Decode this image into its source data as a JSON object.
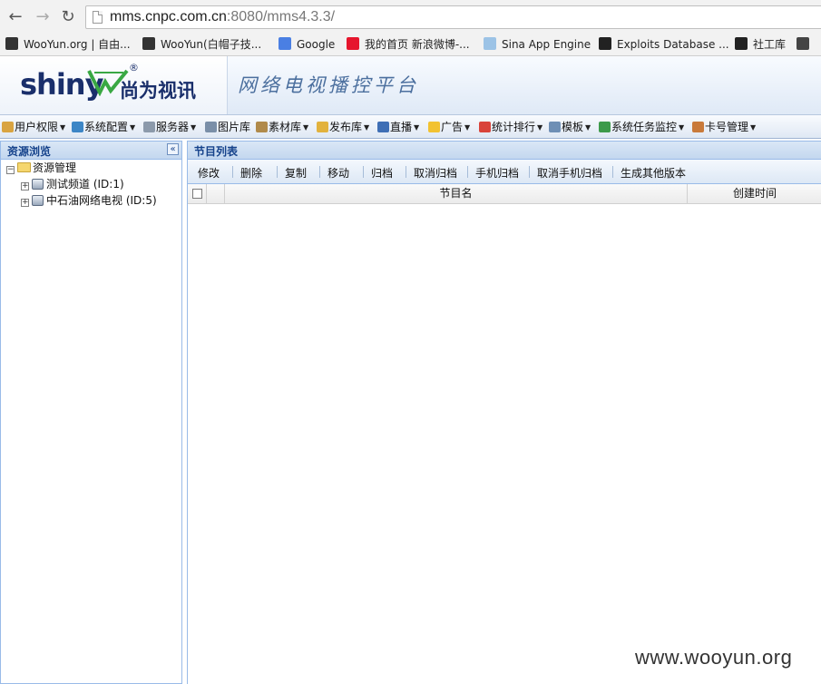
{
  "browser": {
    "url_host": "mms.cnpc.com.cn",
    "url_rest": ":8080/mms4.3.3/",
    "bookmarks": [
      {
        "label": "WooYun.org | 自由...",
        "icon": "wooyun-icon",
        "color": "#333333"
      },
      {
        "label": "WooYun(白帽子技...",
        "icon": "wooyun-icon",
        "color": "#333333"
      },
      {
        "label": "Google",
        "icon": "google-icon",
        "color": "#4a7fe3"
      },
      {
        "label": "我的首页 新浪微博-...",
        "icon": "weibo-icon",
        "color": "#e6162d"
      },
      {
        "label": "Sina App Engine",
        "icon": "cloud-icon",
        "color": "#9cc3e6"
      },
      {
        "label": "Exploits Database ...",
        "icon": "exploit-db-icon",
        "color": "#222222"
      },
      {
        "label": "社工库",
        "icon": "social-icon",
        "color": "#222222"
      },
      {
        "label": "",
        "icon": "bookmark-icon",
        "color": "#444444"
      }
    ]
  },
  "header": {
    "logo_text": "shiny",
    "logo_cn": "尚为视讯",
    "logo_reg": "®",
    "app_title": "网络电视播控平台"
  },
  "menu": [
    {
      "label": "用户权限",
      "color": "#d9a441"
    },
    {
      "label": "系统配置",
      "color": "#3d86c6"
    },
    {
      "label": "服务器",
      "color": "#8c9aab"
    },
    {
      "label": "图片库",
      "color": "#7a8fa8"
    },
    {
      "label": "素材库",
      "color": "#b08a4a"
    },
    {
      "label": "发布库",
      "color": "#e2b23d"
    },
    {
      "label": "直播",
      "color": "#3f6fb5"
    },
    {
      "label": "广告",
      "color": "#f2c230"
    },
    {
      "label": "统计排行",
      "color": "#d9443a"
    },
    {
      "label": "模板",
      "color": "#6e8fb5"
    },
    {
      "label": "系统任务监控",
      "color": "#3d9a4a"
    },
    {
      "label": "卡号管理",
      "color": "#c97a3a"
    }
  ],
  "left_panel": {
    "title": "资源浏览",
    "collapse_glyph": "«",
    "tree": {
      "root": {
        "label": "资源管理",
        "expander": "−"
      },
      "children": [
        {
          "label": "测试频道 (ID:1)",
          "expander": "+"
        },
        {
          "label": "中石油网络电视 (ID:5)",
          "expander": "+"
        }
      ]
    }
  },
  "right_panel": {
    "title": "节目列表",
    "toolbar": [
      "修改",
      "删除",
      "复制",
      "移动",
      "归档",
      "取消归档",
      "手机归档",
      "取消手机归档",
      "生成其他版本"
    ],
    "columns": [
      "节目名",
      "创建时间"
    ],
    "rows": []
  },
  "watermark": "www.wooyun.org"
}
